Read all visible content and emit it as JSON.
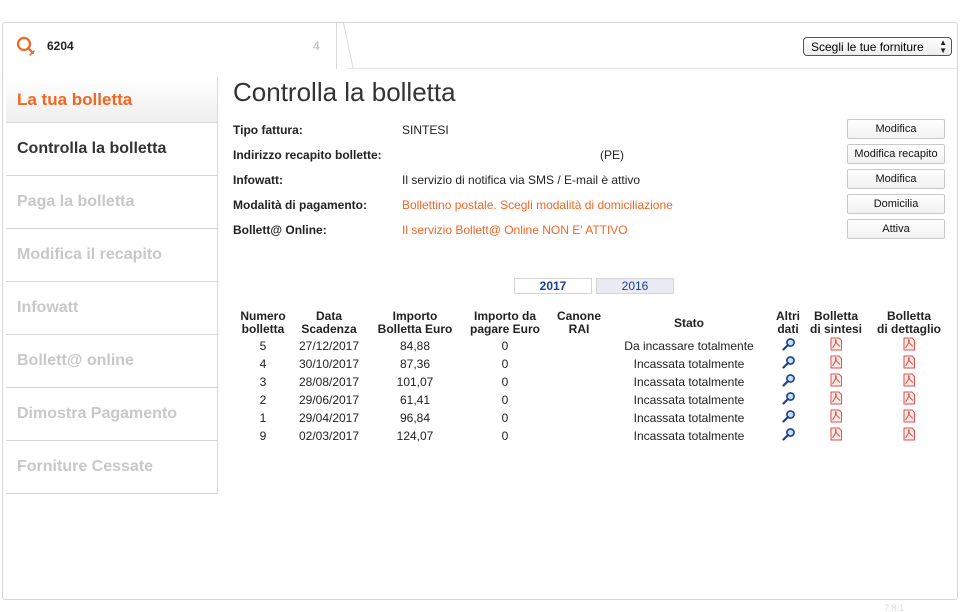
{
  "header": {
    "supply_id": "6204",
    "tab_number": "4",
    "supply_select": {
      "selected": "Scegli le tue forniture"
    }
  },
  "sidebar": {
    "items": [
      {
        "label": "La tua bolletta",
        "state": "header"
      },
      {
        "label": "Controlla la bolletta",
        "state": "active"
      },
      {
        "label": "Paga la bolletta",
        "state": "disabled"
      },
      {
        "label": "Modifica il recapito",
        "state": "disabled"
      },
      {
        "label": "Infowatt",
        "state": "disabled"
      },
      {
        "label": "Bollett@ online",
        "state": "disabled"
      },
      {
        "label": "Dimostra Pagamento",
        "state": "disabled"
      },
      {
        "label": "Forniture Cessate",
        "state": "disabled"
      }
    ]
  },
  "main": {
    "title": "Controlla la bolletta",
    "info": [
      {
        "label": "Tipo fattura:",
        "value": "SINTESI",
        "button": "Modifica"
      },
      {
        "label": "Indirizzo recapito bollette:",
        "value": "(PE)",
        "button": "Modifica recapito"
      },
      {
        "label": "Infowatt:",
        "value": "Il servizio di notifica via SMS / E-mail è attivo",
        "button": "Modifica"
      },
      {
        "label": "Modalità di pagamento:",
        "value": "Bollettino postale. Scegli modalità di domiciliazione",
        "button": "Domicilia"
      },
      {
        "label": "Bollett@ Online:",
        "value": "Il servizio Bollett@ Online NON E' ATTIVO",
        "button": "Attiva"
      }
    ],
    "year_tabs": [
      {
        "label": "2017",
        "active": true
      },
      {
        "label": "2016",
        "active": false
      }
    ],
    "table": {
      "headers": {
        "numero": [
          "Numero",
          "bolletta"
        ],
        "data": [
          "Data",
          "Scadenza"
        ],
        "importo": [
          "Importo",
          "Bolletta Euro"
        ],
        "da_pagare": [
          "Importo da",
          "pagare Euro"
        ],
        "canone": [
          "Canone",
          "RAI"
        ],
        "stato": [
          "Stato"
        ],
        "altri": [
          "Altri",
          "dati"
        ],
        "sintesi": [
          "Bolletta",
          "di sintesi"
        ],
        "dettaglio": [
          "Bolletta",
          "di dettaglio"
        ]
      },
      "rows": [
        {
          "numero": "5",
          "data": "27/12/2017",
          "importo": "84,88",
          "da_pagare": "0",
          "canone": "",
          "stato": "Da incassare totalmente"
        },
        {
          "numero": "4",
          "data": "30/10/2017",
          "importo": "87,36",
          "da_pagare": "0",
          "canone": "",
          "stato": "Incassata totalmente"
        },
        {
          "numero": "3",
          "data": "28/08/2017",
          "importo": "101,07",
          "da_pagare": "0",
          "canone": "",
          "stato": "Incassata totalmente"
        },
        {
          "numero": "2",
          "data": "29/06/2017",
          "importo": "61,41",
          "da_pagare": "0",
          "canone": "",
          "stato": "Incassata totalmente"
        },
        {
          "numero": "1",
          "data": "29/04/2017",
          "importo": "96,84",
          "da_pagare": "0",
          "canone": "",
          "stato": "Incassata totalmente"
        },
        {
          "numero": "9",
          "data": "02/03/2017",
          "importo": "124,07",
          "da_pagare": "0",
          "canone": "",
          "stato": "Incassata totalmente"
        }
      ]
    }
  },
  "footer": {
    "version": "7.8.1"
  },
  "colors": {
    "accent": "#f26522",
    "link_blue": "#1a3e9a",
    "disabled_text": "#c8c8c8"
  },
  "icons": {
    "supply": "lightbulb-icon",
    "details": "magnifier-icon",
    "pdf": "pdf-icon",
    "select": "updown-arrows-icon"
  }
}
